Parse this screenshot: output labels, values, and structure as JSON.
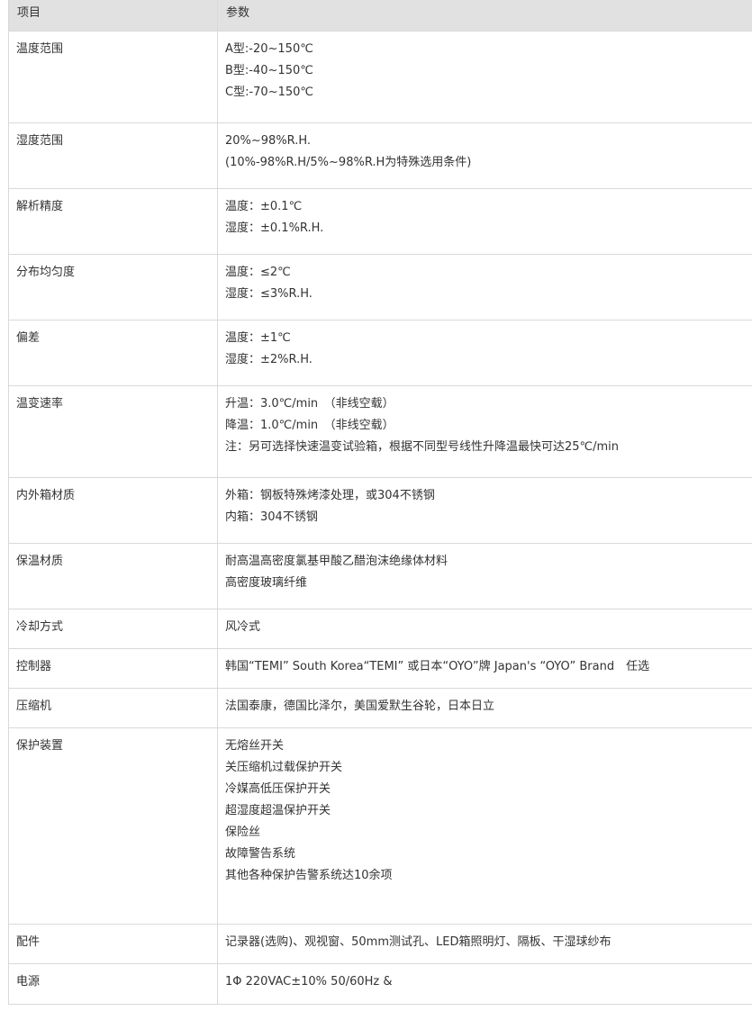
{
  "header": {
    "col_item": "项目",
    "col_param": "参数"
  },
  "rows": [
    {
      "item": "温度范围",
      "lines": [
        "A型:-20~150℃",
        "B型:-40~150℃",
        "C型:-70~150℃"
      ]
    },
    {
      "item": "湿度范围",
      "lines": [
        "20%~98%R.H.",
        "(10%-98%R.H/5%~98%R.H为特殊选用条件)"
      ]
    },
    {
      "item": "解析精度",
      "lines": [
        "温度：±0.1℃",
        "湿度：±0.1%R.H."
      ]
    },
    {
      "item": "分布均匀度",
      "lines": [
        "温度：≤2℃",
        "湿度：≤3%R.H."
      ]
    },
    {
      "item": "偏差",
      "lines": [
        "温度：±1℃",
        "湿度：±2%R.H."
      ]
    },
    {
      "item": "温变速率",
      "lines": [
        "升温：3.0℃/min　（非线空载）",
        "降温：1.0℃/min　（非线空载）",
        "注：另可选择快速温变试验箱，根据不同型号线性升降温最快可达25℃/min"
      ]
    },
    {
      "item": "内外箱材质",
      "lines": [
        "外箱：钢板特殊烤漆处理，或304不锈钢",
        "内箱：304不锈钢"
      ]
    },
    {
      "item": "保温材质",
      "lines": [
        "耐高温高密度氯基甲酸乙醋泡沫绝缘体材料",
        "高密度玻璃纤维"
      ]
    },
    {
      "item": "冷却方式",
      "lines": [
        "风冷式"
      ]
    },
    {
      "item": "控制器",
      "lines": [
        "韩国“TEMI” South Korea“TEMI” 或日本“OYO”牌 Japan's “OYO” Brand　任选"
      ]
    },
    {
      "item": "压缩机",
      "lines": [
        "法国泰康，德国比泽尔，美国爱默生谷轮，日本日立"
      ]
    },
    {
      "item": "保护装置",
      "lines": [
        "无熔丝开关",
        "关压缩机过载保护开关",
        "冷媒高低压保护开关",
        "超湿度超温保护开关",
        "保险丝",
        "故障警告系统",
        "其他各种保护告警系统达10余项"
      ]
    },
    {
      "item": "配件",
      "lines": [
        "记录器(选购)、观视窗、50mm测试孔、LED箱照明灯、隔板、干湿球纱布"
      ]
    },
    {
      "item": "电源",
      "lines": [
        "1Φ 220VAC±10% 50/60Hz &"
      ]
    }
  ]
}
